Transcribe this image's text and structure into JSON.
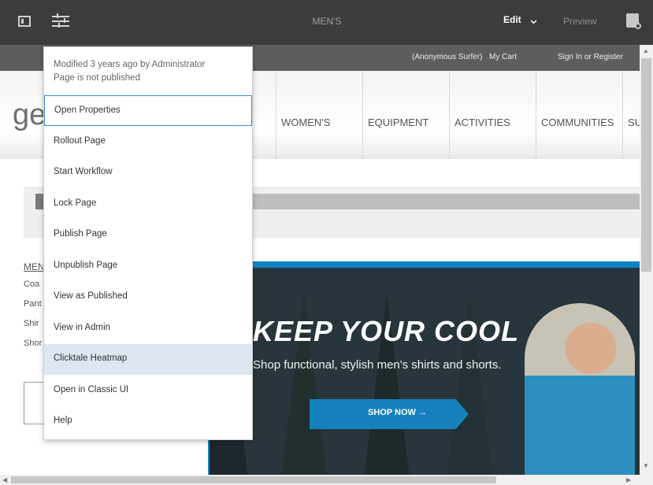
{
  "toolbar": {
    "title": "MEN'S",
    "edit_label": "Edit",
    "preview_label": "Preview",
    "icons": [
      "page-sidebar-icon",
      "page-properties-icon",
      "chevron-down-icon",
      "annotations-icon"
    ]
  },
  "site": {
    "utility_links": [
      "(Anonymous Surfer)",
      "My Cart",
      "Sign In or Register"
    ],
    "logo": "ge",
    "nav": [
      "WOMEN'S",
      "EQUIPMENT",
      "ACTIVITIES",
      "COMMUNITIES",
      "SU"
    ],
    "sidebar_title": "MEN",
    "sidebar_links": [
      "Coa",
      "Pant",
      "Shir",
      "Shor"
    ],
    "hero": {
      "title": "KEEP YOUR COOL",
      "subtitle": "Shop functional, stylish men's shirts and shorts.",
      "button": "SHOP NOW →"
    }
  },
  "menu": {
    "meta_line1": "Modified 3 years ago by Administrator",
    "meta_line2": "Page is not published",
    "items": [
      {
        "label": "Open Properties",
        "state": "focused"
      },
      {
        "label": "Rollout Page",
        "state": ""
      },
      {
        "label": "Start Workflow",
        "state": ""
      },
      {
        "label": "Lock Page",
        "state": ""
      },
      {
        "label": "Publish Page",
        "state": ""
      },
      {
        "label": "Unpublish Page",
        "state": ""
      },
      {
        "label": "View as Published",
        "state": ""
      },
      {
        "label": "View in Admin",
        "state": ""
      },
      {
        "label": "Clicktale Heatmap",
        "state": "hover"
      },
      {
        "label": "Open in Classic UI",
        "state": ""
      },
      {
        "label": "Help",
        "state": ""
      }
    ]
  },
  "colors": {
    "toolbar": "#3c3c3c",
    "accent": "#1682bd",
    "focus": "#3a8ad8",
    "hover": "#dde6f1"
  }
}
